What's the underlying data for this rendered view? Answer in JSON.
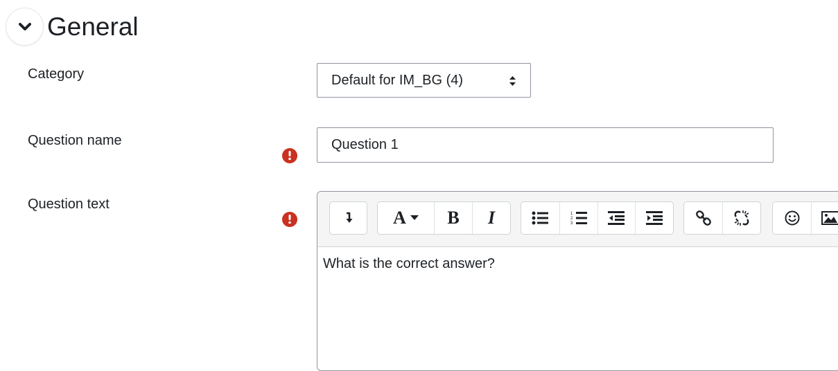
{
  "section": {
    "title": "General",
    "collapse_icon": "chevron-down-icon"
  },
  "category": {
    "label": "Category",
    "selected": "Default for IM_BG (4)"
  },
  "question_name": {
    "label": "Question name",
    "value": "Question 1",
    "required_icon": "exclamation-circle-icon"
  },
  "question_text": {
    "label": "Question text",
    "required_icon": "exclamation-circle-icon",
    "content": "What is the correct answer?",
    "toolbar": {
      "font_button_glyph": "A",
      "bold_glyph": "B",
      "italic_glyph": "I",
      "icons": [
        "collapse-toolbar-icon",
        "font-style-icon",
        "bold-icon",
        "italic-icon",
        "unordered-list-icon",
        "ordered-list-icon",
        "outdent-icon",
        "indent-icon",
        "link-icon",
        "unlink-icon",
        "emoji-icon",
        "image-icon"
      ]
    }
  },
  "colors": {
    "required": "#ca3120",
    "border": "#8f959e",
    "toolbar_bg": "#f5f5f5"
  }
}
